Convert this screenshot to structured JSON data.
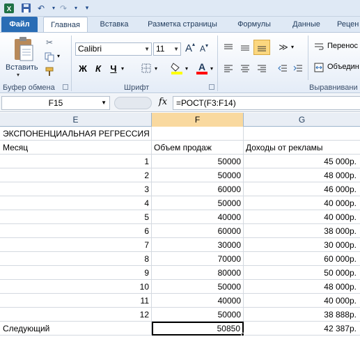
{
  "window": {
    "quick_access": [
      "save-icon",
      "undo-icon",
      "redo-icon",
      "customize-icon"
    ]
  },
  "tabs": {
    "file": "Файл",
    "items": [
      "Главная",
      "Вставка",
      "Разметка страницы",
      "Формулы",
      "Данные",
      "Рецен"
    ],
    "active": "Главная"
  },
  "ribbon": {
    "clipboard": {
      "paste_label": "Вставить",
      "group_label": "Буфер обмена"
    },
    "font": {
      "name": "Calibri",
      "size": "11",
      "bold": "Ж",
      "italic": "К",
      "underline": "Ч",
      "grow": "A",
      "shrink": "A",
      "font_color_letter": "A",
      "group_label": "Шрифт",
      "fill_color": "#ffff00",
      "text_color": "#ff0000"
    },
    "alignment": {
      "wrap_label": "Перенос",
      "merge_label": "Объедин",
      "group_label": "Выравнивани"
    }
  },
  "formula_bar": {
    "name_box": "F15",
    "fx": "fx",
    "formula": "=РОСТ(F3:F14)"
  },
  "grid": {
    "columns": [
      "E",
      "F",
      "G"
    ],
    "selected_column": "F",
    "rows": [
      {
        "e": "ЭКСПОНЕНЦИАЛЬНАЯ РЕГРЕССИЯ",
        "f": "",
        "g": ""
      },
      {
        "e": "Месяц",
        "f": "Объем продаж",
        "g": "Доходы от рекламы",
        "header": true
      },
      {
        "e": "1",
        "f": "50000",
        "g": "45 000р."
      },
      {
        "e": "2",
        "f": "50000",
        "g": "48 000р."
      },
      {
        "e": "3",
        "f": "60000",
        "g": "46 000р."
      },
      {
        "e": "4",
        "f": "50000",
        "g": "40 000р."
      },
      {
        "e": "5",
        "f": "40000",
        "g": "40 000р."
      },
      {
        "e": "6",
        "f": "60000",
        "g": "38 000р."
      },
      {
        "e": "7",
        "f": "30000",
        "g": "30 000р."
      },
      {
        "e": "8",
        "f": "70000",
        "g": "60 000р."
      },
      {
        "e": "9",
        "f": "80000",
        "g": "50 000р."
      },
      {
        "e": "10",
        "f": "50000",
        "g": "48 000р."
      },
      {
        "e": "11",
        "f": "40000",
        "g": "40 000р."
      },
      {
        "e": "12",
        "f": "50000",
        "g": "38 888р."
      },
      {
        "e": "Следующий",
        "f": "50850",
        "g": "42 387р.",
        "active": true
      }
    ]
  }
}
